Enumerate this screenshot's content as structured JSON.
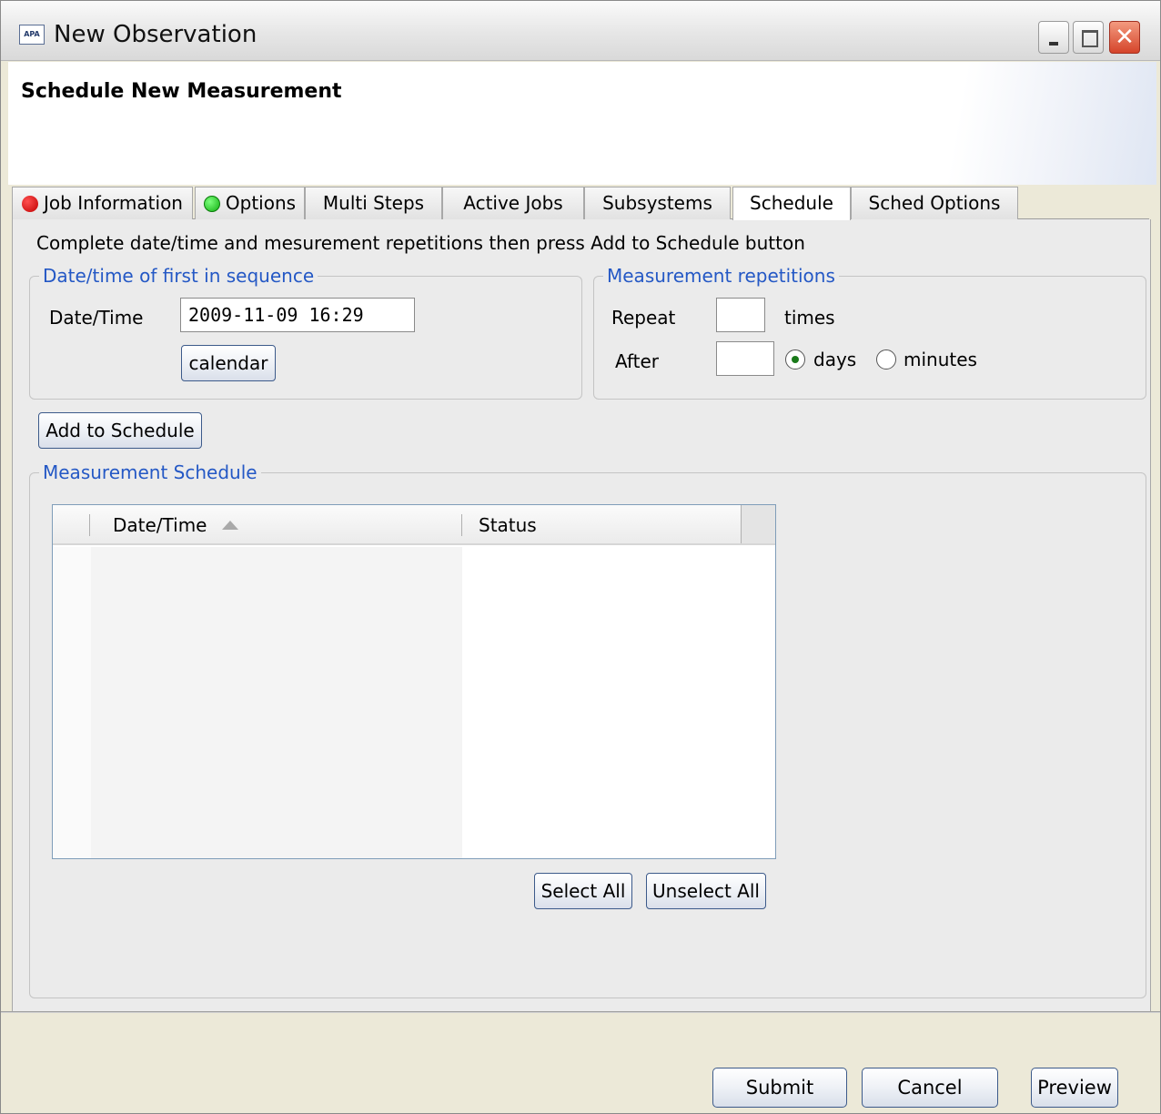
{
  "window": {
    "app_icon_text": "APA",
    "title": "New Observation"
  },
  "header": {
    "title": "Schedule New Measurement"
  },
  "tabs": [
    {
      "label": "Job Information",
      "status": "red"
    },
    {
      "label": "Options",
      "status": "green"
    },
    {
      "label": "Multi Steps"
    },
    {
      "label": "Active Jobs"
    },
    {
      "label": "Subsystems"
    },
    {
      "label": "Schedule",
      "active": true
    },
    {
      "label": "Sched Options"
    }
  ],
  "schedule": {
    "instructions": "Complete date/time and mesurement repetitions then press Add to Schedule button",
    "first_group": {
      "legend": "Date/time of first in sequence",
      "datetime_label": "Date/Time",
      "datetime_value": "2009-11-09 16:29",
      "calendar_button": "calendar"
    },
    "repetitions_group": {
      "legend": "Measurement repetitions",
      "repeat_label": "Repeat",
      "repeat_value": "",
      "times_label": "times",
      "after_label": "After",
      "after_value": "",
      "unit_days": "days",
      "unit_minutes": "minutes",
      "selected_unit": "days"
    },
    "add_button": "Add to Schedule",
    "schedule_group": {
      "legend": "Measurement Schedule",
      "columns": [
        "Date/Time",
        "Status"
      ],
      "sort_column": "Date/Time",
      "rows": [],
      "select_all": "Select All",
      "unselect_all": "Unselect All"
    }
  },
  "footer": {
    "submit": "Submit",
    "cancel": "Cancel",
    "preview": "Preview"
  },
  "colors": {
    "legend_text": "#2458c5",
    "status_red": "#d00000",
    "status_green": "#22c022"
  }
}
